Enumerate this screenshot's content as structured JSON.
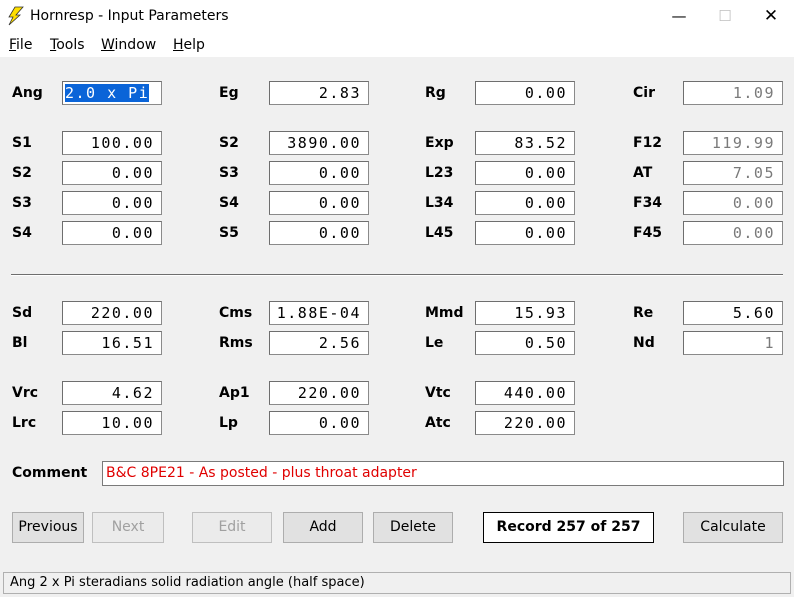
{
  "window": {
    "title": "Hornresp - Input Parameters",
    "minimize": "—",
    "maximize": "☐",
    "close": "✕"
  },
  "menu": [
    {
      "label": "File",
      "accel": "F",
      "rest": "ile"
    },
    {
      "label": "Tools",
      "accel": "T",
      "rest": "ools"
    },
    {
      "label": "Window",
      "accel": "W",
      "rest": "indow"
    },
    {
      "label": "Help",
      "accel": "H",
      "rest": "elp"
    }
  ],
  "params": {
    "ang": {
      "label": "Ang",
      "value": "2.0 x Pi"
    },
    "eg": {
      "label": "Eg",
      "value": "2.83"
    },
    "rg": {
      "label": "Rg",
      "value": "0.00"
    },
    "cir": {
      "label": "Cir",
      "value": "1.09"
    },
    "s1": {
      "label": "S1",
      "value": "100.00"
    },
    "s2b": {
      "label": "S2",
      "value": "3890.00"
    },
    "exp": {
      "label": "Exp",
      "value": "83.52"
    },
    "f12": {
      "label": "F12",
      "value": "119.99"
    },
    "s2": {
      "label": "S2",
      "value": "0.00"
    },
    "s3b": {
      "label": "S3",
      "value": "0.00"
    },
    "l23": {
      "label": "L23",
      "value": "0.00"
    },
    "at": {
      "label": "AT",
      "value": "7.05"
    },
    "s3": {
      "label": "S3",
      "value": "0.00"
    },
    "s4b": {
      "label": "S4",
      "value": "0.00"
    },
    "l34": {
      "label": "L34",
      "value": "0.00"
    },
    "f34": {
      "label": "F34",
      "value": "0.00"
    },
    "s4": {
      "label": "S4",
      "value": "0.00"
    },
    "s5": {
      "label": "S5",
      "value": "0.00"
    },
    "l45": {
      "label": "L45",
      "value": "0.00"
    },
    "f45": {
      "label": "F45",
      "value": "0.00"
    },
    "sd": {
      "label": "Sd",
      "value": "220.00"
    },
    "cms": {
      "label": "Cms",
      "value": "1.88E-04"
    },
    "mmd": {
      "label": "Mmd",
      "value": "15.93"
    },
    "re": {
      "label": "Re",
      "value": "5.60"
    },
    "bl": {
      "label": "Bl",
      "value": "16.51"
    },
    "rms": {
      "label": "Rms",
      "value": "2.56"
    },
    "le": {
      "label": "Le",
      "value": "0.50"
    },
    "nd": {
      "label": "Nd",
      "value": "1"
    },
    "vrc": {
      "label": "Vrc",
      "value": "4.62"
    },
    "ap1": {
      "label": "Ap1",
      "value": "220.00"
    },
    "vtc": {
      "label": "Vtc",
      "value": "440.00"
    },
    "lrc": {
      "label": "Lrc",
      "value": "10.00"
    },
    "lp": {
      "label": "Lp",
      "value": "0.00"
    },
    "atc": {
      "label": "Atc",
      "value": "220.00"
    }
  },
  "comment": {
    "label": "Comment",
    "value": "B&C 8PE21 - As posted - plus throat adapter",
    "color": "#e00000"
  },
  "buttons": {
    "previous": "Previous",
    "next": "Next",
    "edit": "Edit",
    "add": "Add",
    "delete": "Delete",
    "calculate": "Calculate"
  },
  "record": "Record 257 of 257",
  "status": "Ang   2 x Pi steradians solid radiation angle  (half space)",
  "colors": {
    "selection": "#0a64d8",
    "readonly_text": "#7a7a7a",
    "icon": "#ffe000"
  }
}
